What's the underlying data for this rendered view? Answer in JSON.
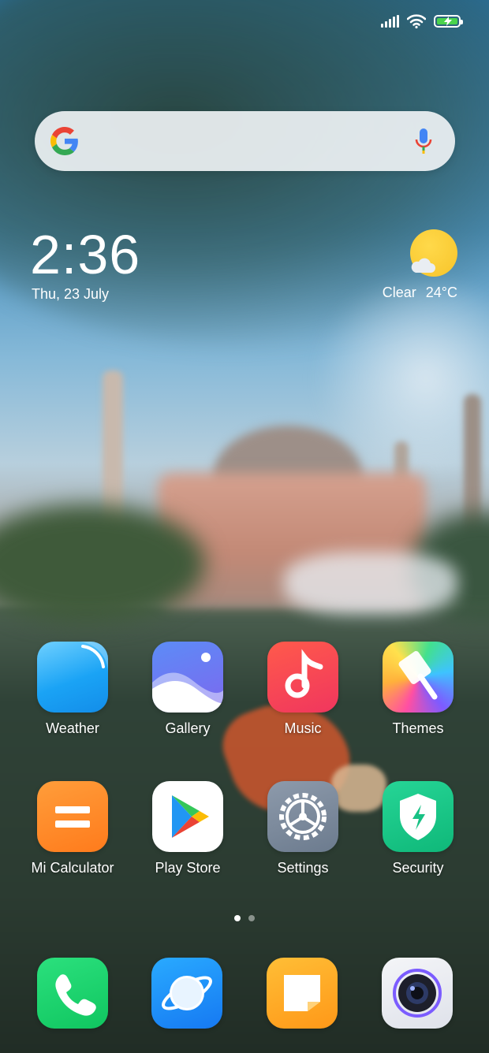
{
  "status_bar": {
    "icons": [
      "signal-icon",
      "wifi-icon",
      "battery-charging-icon"
    ],
    "battery_color": "#49d34c"
  },
  "search_bar": {
    "icons": [
      "google-logo-icon",
      "microphone-icon"
    ]
  },
  "clock": {
    "time": "2:36",
    "date": "Thu, 23 July"
  },
  "weather_widget": {
    "condition": "Clear",
    "temperature": "24°C",
    "icon": "sun-cloud-icon"
  },
  "apps": [
    {
      "label": "Weather",
      "icon": "weather-app-icon"
    },
    {
      "label": "Gallery",
      "icon": "gallery-app-icon"
    },
    {
      "label": "Music",
      "icon": "music-app-icon"
    },
    {
      "label": "Themes",
      "icon": "themes-app-icon"
    },
    {
      "label": "Mi Calculator",
      "icon": "calculator-app-icon"
    },
    {
      "label": "Play Store",
      "icon": "play-store-app-icon"
    },
    {
      "label": "Settings",
      "icon": "settings-app-icon"
    },
    {
      "label": "Security",
      "icon": "security-app-icon"
    }
  ],
  "page_indicator": {
    "total": 2,
    "current": 1
  },
  "dock": [
    "phone-app-icon",
    "browser-app-icon",
    "notes-app-icon",
    "camera-app-icon"
  ]
}
